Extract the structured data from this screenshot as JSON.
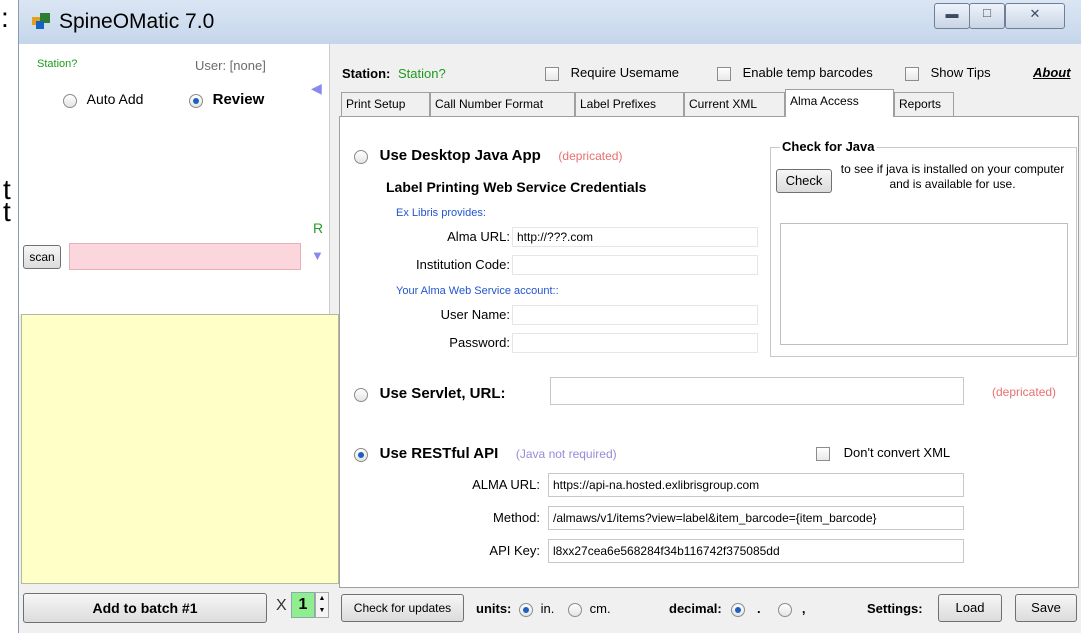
{
  "edge_glyphs": [
    ":",
    "t",
    "t"
  ],
  "window": {
    "title": "SpineOMatic 7.0"
  },
  "left": {
    "station_label": "Station?",
    "user_label": "User: [none]",
    "auto_add_label": "Auto Add",
    "review_label": "Review",
    "r_label": "R",
    "scan_label": "scan",
    "scan_value": "",
    "add_batch_label": "Add to batch #1",
    "x_label": "X",
    "batch_count": "1"
  },
  "top": {
    "station_label": "Station:",
    "station_value": "Station?",
    "require_username_label": "Require Usemame",
    "enable_temp_label": "Enable temp barcodes",
    "show_tips_label": "Show Tips",
    "about_label": "About"
  },
  "tabs": [
    {
      "label": "Print Setup"
    },
    {
      "label": "Call Number Format"
    },
    {
      "label": "Label Prefixes"
    },
    {
      "label": "Current XML"
    },
    {
      "label": "Alma Access"
    },
    {
      "label": "Reports"
    }
  ],
  "alma": {
    "desktop_label": "Use Desktop Java App",
    "desktop_note": "(depricated)",
    "credentials_title": "Label Printing Web Service Credentials",
    "exlibris_provides": "Ex Libris provides:",
    "alma_url_label": "Alma URL:",
    "alma_url_value": "http://???.com",
    "institution_label": "Institution Code:",
    "institution_value": "",
    "account_label": "Your Alma Web Service account::",
    "username_label": "User Name:",
    "username_value": "",
    "password_label": "Password:",
    "password_value": "",
    "check_java_title": "Check for Java",
    "check_button": "Check",
    "check_desc": "to see if java is installed on your computer and is available for use.",
    "servlet_label": "Use Servlet, URL:",
    "servlet_value": "",
    "servlet_note": "(depricated)",
    "restful_label": "Use RESTful API",
    "restful_note": "(Java not required)",
    "dont_convert_label": "Don't convert XML",
    "rest_url_label": "ALMA URL:",
    "rest_url_value": "https://api-na.hosted.exlibrisgroup.com",
    "method_label": "Method:",
    "method_value": "/almaws/v1/items?view=label&item_barcode={item_barcode}",
    "apikey_label": "API Key:",
    "apikey_value": "l8xx27cea6e568284f34b116742f375085dd"
  },
  "bottom": {
    "check_updates": "Check for updates",
    "units_label": "units:",
    "in_label": "in.",
    "cm_label": "cm.",
    "decimal_label": "decimal:",
    "dot_label": ".",
    "comma_label": ",",
    "settings_label": "Settings:",
    "load_label": "Load",
    "save_label": "Save"
  }
}
